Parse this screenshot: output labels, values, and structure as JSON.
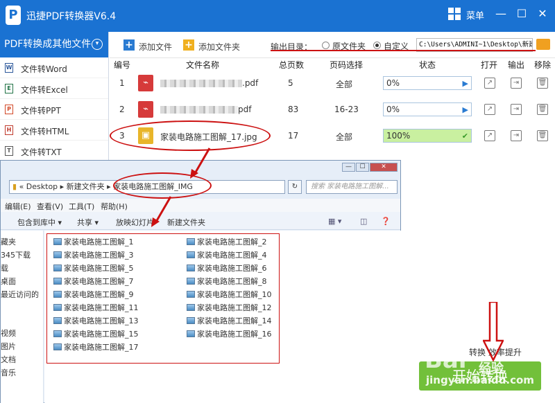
{
  "app": {
    "logo": "P",
    "title": "迅捷PDF转换器V6.4",
    "menu_label": "菜单"
  },
  "sidebar": {
    "header": "PDF转换成其他文件",
    "items": [
      {
        "label": "文件转Word",
        "icon": "W",
        "color": "#2b579a"
      },
      {
        "label": "文件转Excel",
        "icon": "E",
        "color": "#217346"
      },
      {
        "label": "文件转PPT",
        "icon": "P",
        "color": "#d24726"
      },
      {
        "label": "文件转HTML",
        "icon": "H",
        "color": "#c0392b"
      },
      {
        "label": "文件转TXT",
        "icon": "T",
        "color": "#555555"
      }
    ]
  },
  "toolbar": {
    "add_file": "添加文件",
    "add_folder": "添加文件夹",
    "output_dir_label": "输出目录：",
    "option_original": "原文件夹",
    "option_custom": "自定义",
    "path": "C:\\Users\\ADMINI~1\\Desktop\\新建文"
  },
  "table": {
    "headers": [
      "编号",
      "文件名称",
      "总页数",
      "页码选择",
      "状态",
      "打开",
      "输出",
      "移除"
    ],
    "rows": [
      {
        "num": "1",
        "name_suffix": ".pdf",
        "pages": "5",
        "selection": "全部",
        "status": "0%",
        "progress": 0,
        "type": "pdf"
      },
      {
        "num": "2",
        "name_suffix": "pdf",
        "pages": "83",
        "selection": "16-23",
        "status": "0%",
        "progress": 0,
        "type": "pdf"
      },
      {
        "num": "3",
        "name": "家装电路施工图解_17.jpg",
        "pages": "17",
        "selection": "全部",
        "status": "100%",
        "progress": 1,
        "type": "jpg"
      }
    ]
  },
  "bottom": {
    "convert_text": "转换 效率提升",
    "start_button": "开始转换",
    "watermark_main": "Bai",
    "watermark_sub": "经验",
    "watermark_url": "jingyan.baidu.com"
  },
  "explorer": {
    "address": [
      "«",
      "Desktop",
      "新建文件夹",
      "家装电路施工图解_IMG"
    ],
    "search_placeholder": "搜索 家装电路施工图解...",
    "menu": [
      "编辑(E)",
      "查看(V)",
      "工具(T)",
      "帮助(H)"
    ],
    "commands": [
      "包含到库中 ▾",
      "共享 ▾",
      "放映幻灯片",
      "新建文件夹"
    ],
    "nav_items": [
      "藏夹",
      "345下载",
      "载",
      "桌面",
      "最近访问的",
      "",
      "视频",
      "图片",
      "文档",
      "音乐"
    ],
    "files_left": [
      "家装电路施工图解_1",
      "家装电路施工图解_3",
      "家装电路施工图解_5",
      "家装电路施工图解_7",
      "家装电路施工图解_9",
      "家装电路施工图解_11",
      "家装电路施工图解_13",
      "家装电路施工图解_15",
      "家装电路施工图解_17"
    ],
    "files_right": [
      "家装电路施工图解_2",
      "家装电路施工图解_4",
      "家装电路施工图解_6",
      "家装电路施工图解_8",
      "家装电路施工图解_10",
      "家装电路施工图解_12",
      "家装电路施工图解_14",
      "家装电路施工图解_16"
    ]
  },
  "colors": {
    "brand": "#1a72d2",
    "annotation": "#cc1111",
    "start": "#72c03a"
  }
}
